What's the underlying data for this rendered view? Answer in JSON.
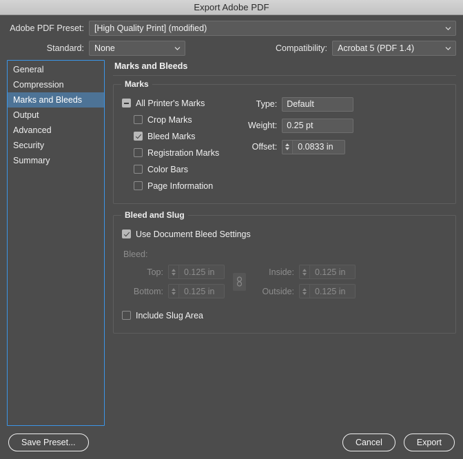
{
  "window": {
    "title": "Export Adobe PDF"
  },
  "top": {
    "preset_label": "Adobe PDF Preset:",
    "preset_value": "[High Quality Print] (modified)",
    "standard_label": "Standard:",
    "standard_value": "None",
    "compatibility_label": "Compatibility:",
    "compatibility_value": "Acrobat 5 (PDF 1.4)"
  },
  "sidebar": {
    "items": [
      {
        "label": "General",
        "selected": false
      },
      {
        "label": "Compression",
        "selected": false
      },
      {
        "label": "Marks and Bleeds",
        "selected": true
      },
      {
        "label": "Output",
        "selected": false
      },
      {
        "label": "Advanced",
        "selected": false
      },
      {
        "label": "Security",
        "selected": false
      },
      {
        "label": "Summary",
        "selected": false
      }
    ]
  },
  "panel": {
    "title": "Marks and Bleeds",
    "marks": {
      "group_title": "Marks",
      "all_printers_marks": {
        "label": "All Printer's Marks",
        "state": "mixed"
      },
      "checkboxes": [
        {
          "label": "Crop Marks",
          "checked": false
        },
        {
          "label": "Bleed Marks",
          "checked": true
        },
        {
          "label": "Registration Marks",
          "checked": false
        },
        {
          "label": "Color Bars",
          "checked": false
        },
        {
          "label": "Page Information",
          "checked": false
        }
      ],
      "type_label": "Type:",
      "type_value": "Default",
      "weight_label": "Weight:",
      "weight_value": "0.25 pt",
      "offset_label": "Offset:",
      "offset_value": "0.0833 in"
    },
    "bleed_and_slug": {
      "group_title": "Bleed and Slug",
      "use_document_bleed": {
        "label": "Use Document Bleed Settings",
        "checked": true
      },
      "bleed_caption": "Bleed:",
      "top_label": "Top:",
      "top_value": "0.125 in",
      "bottom_label": "Bottom:",
      "bottom_value": "0.125 in",
      "inside_label": "Inside:",
      "inside_value": "0.125 in",
      "outside_label": "Outside:",
      "outside_value": "0.125 in",
      "include_slug": {
        "label": "Include Slug Area",
        "checked": false
      }
    }
  },
  "footer": {
    "save_preset_label": "Save Preset...",
    "cancel_label": "Cancel",
    "export_label": "Export"
  },
  "colors": {
    "dialog_bg": "#4c4c4c",
    "titlebar_bg": "#cccccc",
    "selection_blue": "#4d7396",
    "focus_border": "#3b96e8",
    "field_bg": "#5a5a5a",
    "text": "#f0f0f0",
    "disabled_text": "#8d8d8d"
  }
}
